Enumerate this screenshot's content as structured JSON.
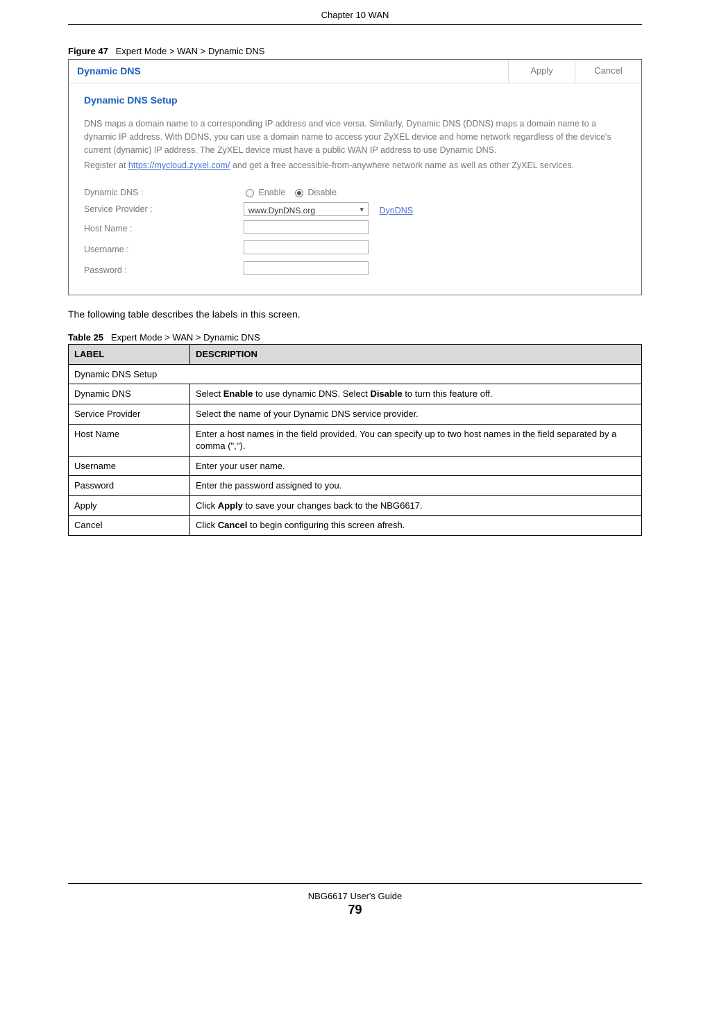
{
  "chapter": "Chapter 10 WAN",
  "figure": {
    "number": "Figure 47",
    "caption": "Expert Mode > WAN > Dynamic DNS",
    "title": "Dynamic DNS",
    "apply": "Apply",
    "cancel": "Cancel",
    "setup_title": "Dynamic DNS Setup",
    "desc1": "DNS maps a domain name to a corresponding IP address and vice versa. Similarly, Dynamic DNS (DDNS) maps a domain name to a dynamic IP address. With DDNS, you can use a domain name to access your ZyXEL device and home network regardless of the device's current (dynamic) IP address. The ZyXEL device must have a public WAN IP address to use Dynamic DNS.",
    "desc2a": "Register at ",
    "desc2link": "https://mycloud.zyxel.com/",
    "desc2b": " and get a free accessible-from-anywhere network name as well as other ZyXEL services.",
    "labels": {
      "ddns": "Dynamic DNS :",
      "enable": "Enable",
      "disable": "Disable",
      "provider": "Service Provider :",
      "provider_val": "www.DynDNS.org",
      "provider_link": "DynDNS",
      "host": "Host Name :",
      "user": "Username :",
      "pass": "Password :"
    }
  },
  "intro": "The following table describes the labels in this screen.",
  "table": {
    "number": "Table 25",
    "caption": "Expert Mode > WAN > Dynamic DNS",
    "h_label": "LABEL",
    "h_desc": "DESCRIPTION",
    "rows": [
      {
        "label": "Dynamic DNS Setup",
        "desc": "",
        "span": true
      },
      {
        "label": "Dynamic DNS",
        "desc_pre": "Select ",
        "b1": "Enable",
        "mid": " to use dynamic DNS. Select ",
        "b2": "Disable",
        "desc_post": " to turn this feature off."
      },
      {
        "label": "Service Provider",
        "desc": "Select the name of your Dynamic DNS service provider."
      },
      {
        "label": "Host Name",
        "desc": "Enter a host names in the field provided. You can specify up to two host names in the field separated by a comma (\",\")."
      },
      {
        "label": "Username",
        "desc": "Enter your user name."
      },
      {
        "label": "Password",
        "desc": "Enter the password assigned to you."
      },
      {
        "label": "Apply",
        "desc_pre": "Click ",
        "b1": "Apply",
        "desc_post": " to save your changes back to the NBG6617."
      },
      {
        "label": "Cancel",
        "desc_pre": "Click ",
        "b1": "Cancel",
        "desc_post": " to begin configuring this screen afresh."
      }
    ]
  },
  "footer": {
    "guide": "NBG6617 User's Guide",
    "page": "79"
  }
}
